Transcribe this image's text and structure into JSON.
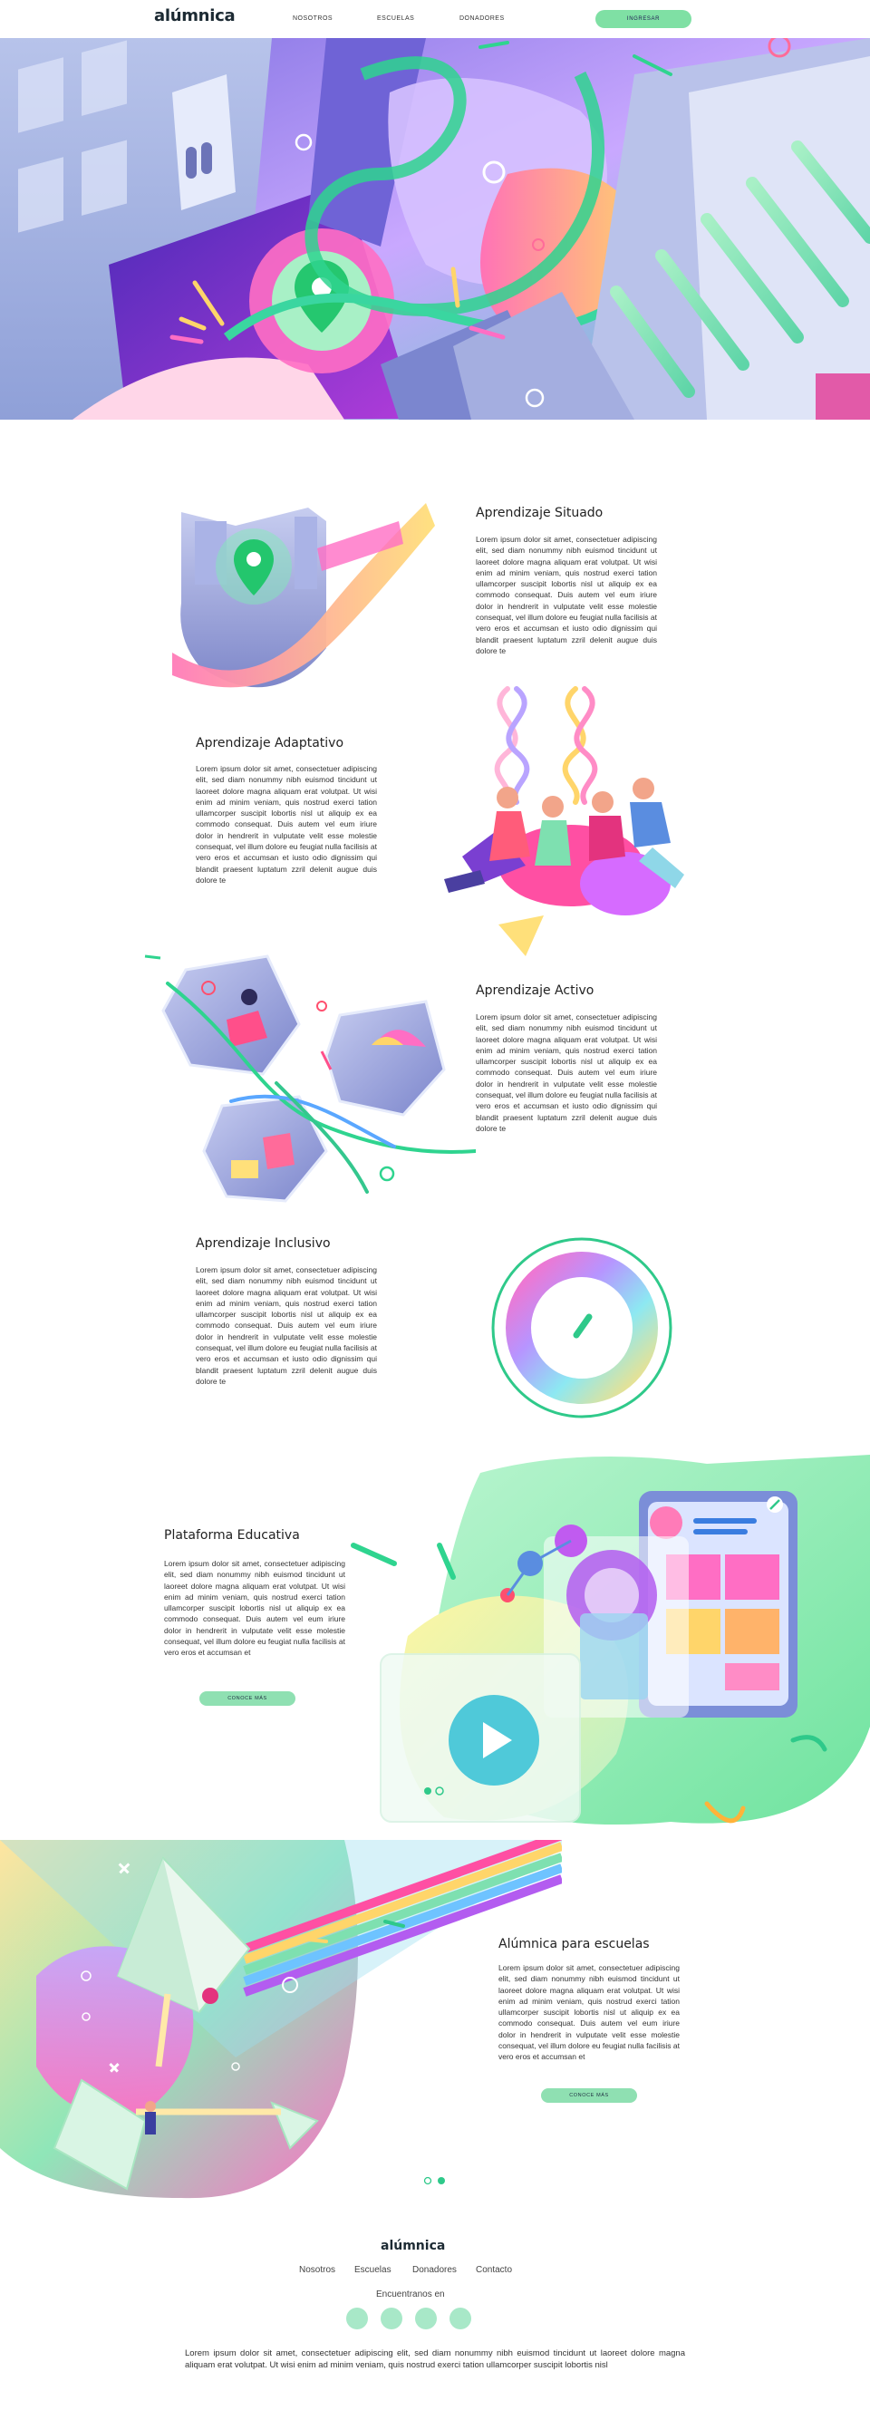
{
  "nav": {
    "logo": "alúmnica",
    "links": [
      "NOSOTROS",
      "ESCUELAS",
      "DONADORES"
    ],
    "cta": "INGRESAR"
  },
  "sections": [
    {
      "title": "Aprendizaje Situado",
      "body": "Lorem ipsum dolor sit amet, consectetuer adipiscing elit, sed diam nonummy nibh euismod tincidunt ut laoreet dolore magna aliquam erat volutpat. Ut wisi enim ad minim veniam, quis nostrud exerci tation ullamcorper suscipit lobortis nisl ut aliquip ex ea commodo consequat. Duis autem vel eum iriure dolor in hendrerit in vulputate velit esse molestie consequat, vel illum dolore eu feugiat nulla facilisis at vero eros et accumsan et iusto odio dignissim qui blandit praesent luptatum zzril delenit augue duis dolore te"
    },
    {
      "title": "Aprendizaje Adaptativo",
      "body": "Lorem ipsum dolor sit amet, consectetuer adipiscing elit, sed diam nonummy nibh euismod tincidunt ut laoreet dolore magna aliquam erat volutpat. Ut wisi enim ad minim veniam, quis nostrud exerci tation ullamcorper suscipit lobortis nisl ut aliquip ex ea commodo consequat. Duis autem vel eum iriure dolor in hendrerit in vulputate velit esse molestie consequat, vel illum dolore eu feugiat nulla facilisis at vero eros et accumsan et iusto odio dignissim qui blandit praesent luptatum zzril delenit augue duis dolore te"
    },
    {
      "title": "Aprendizaje Activo",
      "body": "Lorem ipsum dolor sit amet, consectetuer adipiscing elit, sed diam nonummy nibh euismod tincidunt ut laoreet dolore magna aliquam erat volutpat. Ut wisi enim ad minim veniam, quis nostrud exerci tation ullamcorper suscipit lobortis nisl ut aliquip ex ea commodo consequat. Duis autem vel eum iriure dolor in hendrerit in vulputate velit esse molestie consequat, vel illum dolore eu feugiat nulla facilisis at vero eros et accumsan et iusto odio dignissim qui blandit praesent luptatum zzril delenit augue duis dolore te"
    },
    {
      "title": "Aprendizaje Inclusivo",
      "body": "Lorem ipsum dolor sit amet, consectetuer adipiscing elit, sed diam nonummy nibh euismod tincidunt ut laoreet dolore magna aliquam erat volutpat. Ut wisi enim ad minim veniam, quis nostrud exerci tation ullamcorper suscipit lobortis nisl ut aliquip ex ea commodo consequat. Duis autem vel eum iriure dolor in hendrerit in vulputate velit esse molestie consequat, vel illum dolore eu feugiat nulla facilisis at vero eros et accumsan et iusto odio dignissim qui blandit praesent luptatum zzril delenit augue duis dolore te"
    },
    {
      "title": "Plataforma Educativa",
      "body": "Lorem ipsum dolor sit amet, consectetuer adipiscing elit, sed diam nonummy nibh euismod tincidunt ut laoreet dolore magna aliquam erat volutpat. Ut wisi enim ad minim veniam, quis nostrud exerci tation ullamcorper suscipit lobortis nisl ut aliquip ex ea commodo consequat. Duis autem vel eum iriure dolor in hendrerit in vulputate velit esse molestie consequat, vel illum dolore eu feugiat nulla facilisis at vero eros et accumsan et",
      "button": "CONOCE MÁS"
    },
    {
      "title": "Alúmnica para escuelas",
      "body": "Lorem ipsum dolor sit amet, consectetuer adipiscing elit, sed diam nonummy nibh euismod tincidunt ut laoreet dolore magna aliquam erat volutpat. Ut wisi enim ad minim veniam, quis nostrud exerci tation ullamcorper suscipit lobortis nisl ut aliquip ex ea commodo consequat. Duis autem vel eum iriure dolor in hendrerit in vulputate velit esse molestie consequat, vel illum dolore eu feugiat nulla facilisis at vero eros et accumsan et",
      "button": "CONOCE MÁS"
    }
  ],
  "footer": {
    "logo": "alúmnica",
    "links": [
      "Nosotros",
      "Escuelas",
      "Donadores",
      "Contacto"
    ],
    "find_us": "Encuentranos en",
    "text": "Lorem ipsum dolor sit amet, consectetuer adipiscing elit, sed diam nonummy nibh euismod tincidunt ut laoreet dolore magna aliquam erat volutpat. Ut wisi enim ad minim veniam, quis nostrud exerci tation ullamcorper suscipit lobortis nisl"
  },
  "colors": {
    "accent_green": "#22c87a",
    "mint": "#8fe0b2",
    "purple": "#7a3fd1",
    "pink": "#ee5aa8",
    "yellow": "#ffd56a"
  }
}
